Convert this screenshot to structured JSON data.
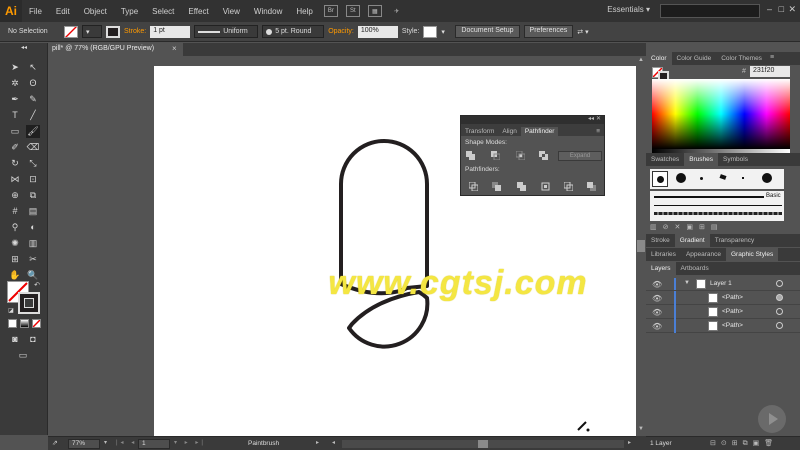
{
  "app": {
    "logo": "Ai",
    "menus": [
      "File",
      "Edit",
      "Object",
      "Type",
      "Select",
      "Effect",
      "View",
      "Window",
      "Help"
    ],
    "menu_icons": [
      "Br",
      "St"
    ],
    "workspace": "Essentials"
  },
  "control_bar": {
    "selection": "No Selection",
    "stroke_label": "Stroke:",
    "stroke_weight": "1 pt",
    "stroke_profile": "Uniform",
    "brush": "5 pt. Round",
    "opacity_label": "Opacity:",
    "opacity_value": "100%",
    "style_label": "Style:",
    "document_setup": "Document Setup",
    "preferences": "Preferences"
  },
  "document_tab": {
    "title": "pill* @ 77% (RGB/GPU Preview)",
    "close": "×"
  },
  "pathfinder_panel": {
    "tabs": [
      "Transform",
      "Align",
      "Pathfinder"
    ],
    "active_tab": "Pathfinder",
    "shape_modes_label": "Shape Modes:",
    "pathfinders_label": "Pathfinders:",
    "expand": "Expand"
  },
  "color_panel": {
    "tabs": [
      "Color",
      "Color Guide",
      "Color Themes"
    ],
    "hex": "231f20"
  },
  "swatch_panel": {
    "tabs": [
      "Swatches",
      "Brushes",
      "Symbols"
    ],
    "brush_name": "Basic"
  },
  "stroke_panel": {
    "tabs": [
      "Stroke",
      "Gradient",
      "Transparency"
    ]
  },
  "library_panel": {
    "tabs": [
      "Libraries",
      "Appearance",
      "Graphic Styles"
    ]
  },
  "layers_panel": {
    "tabs": [
      "Layers",
      "Artboards"
    ],
    "rows": [
      {
        "name": "Layer 1"
      },
      {
        "name": "<Path>"
      },
      {
        "name": "<Path>"
      },
      {
        "name": "<Path>"
      }
    ],
    "footer": "1 Layer"
  },
  "status_bar": {
    "zoom": "77%",
    "artboard": "1",
    "tool": "Paintbrush"
  },
  "watermark": "www.cgtsj.com",
  "colors": {
    "accent": "#ff9a00",
    "watermark": "#f4e642",
    "stroke": "#231f20"
  }
}
